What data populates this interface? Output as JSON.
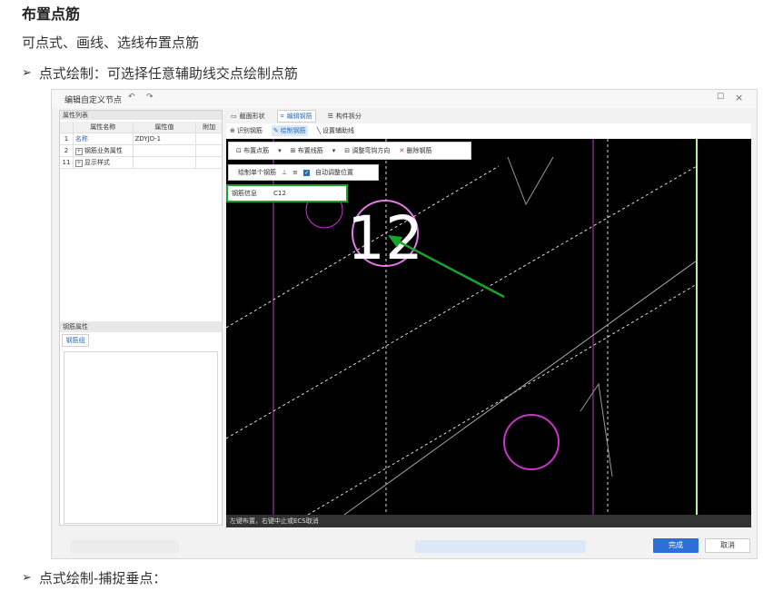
{
  "doc": {
    "title": "布置点筋",
    "subtitle": "可点式、画线、选线布置点筋",
    "bullet1": "点式绘制：可选择任意辅助线交点绘制点筋",
    "bullet2": "点式绘制-捕捉垂点："
  },
  "window": {
    "title": "编辑自定义节点",
    "undo_icon": "undo-icon",
    "redo_icon": "redo-icon",
    "maximize_icon": "maximize-icon",
    "close_icon": "close-icon"
  },
  "left_panel": {
    "title": "属性列表",
    "columns": [
      "属性名称",
      "属性值",
      "附加"
    ],
    "rows": [
      {
        "no": "1",
        "name": "名称",
        "value": "ZDYJD-1",
        "expand": false
      },
      {
        "no": "2",
        "name": "钢筋业务属性",
        "value": "",
        "expand": true
      },
      {
        "no": "11",
        "name": "显示样式",
        "value": "",
        "expand": true
      }
    ],
    "rebar_props_title": "钢筋属性",
    "rebar_group_tab": "钢筋组"
  },
  "tabs": [
    "截面形状",
    "编辑钢筋",
    "构件拆分"
  ],
  "subtoolbar": [
    "识别钢筋",
    "绘制钢筋",
    "设置辅助线"
  ],
  "canvas_toolbar": {
    "place_point": "布置点筋",
    "place_line": "布置线筋",
    "adjust_hook": "调整弯钩方向",
    "delete": "删除钢筋",
    "draw_single": "绘制单个钢筋",
    "auto_adjust": "自动调整位置"
  },
  "rebar_info": {
    "label": "钢筋信息",
    "value": "C12"
  },
  "canvas_label": "12",
  "status_text": "左键布置，右键中止或ECS取消",
  "buttons": {
    "ok": "完成",
    "cancel": "取消"
  },
  "colors": {
    "accent": "#2d6fd6",
    "highlight": "#1aa32a",
    "rebar": "#cc33cc"
  }
}
